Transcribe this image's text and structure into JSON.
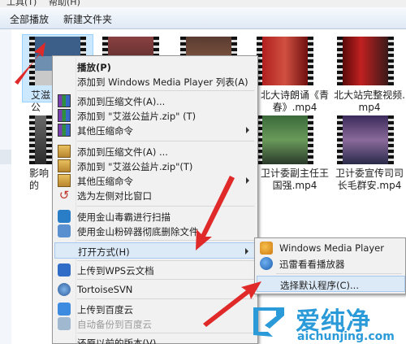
{
  "menubar": {
    "items": [
      "工具(T)",
      "帮助(H)"
    ]
  },
  "toolbar": {
    "play_all": "全部播放",
    "new_folder": "新建文件夹"
  },
  "files": [
    {
      "name": "艾滋公益片"
    },
    {
      "name": ""
    },
    {
      "name": ""
    },
    {
      "name": ""
    },
    {
      "name": "北大诗朗诵《青春》.mp4"
    },
    {
      "name": "北大站完整视频.mp4"
    },
    {
      "name": "影响的"
    },
    {
      "name": ""
    },
    {
      "name": ""
    },
    {
      "name": ""
    },
    {
      "name": "卫计委副主任王国强.mp4"
    },
    {
      "name": "卫计委宣传司司长毛群安.mp4"
    }
  ],
  "file_captions": {
    "f0": "艾滋公",
    "f4a": "北大诗朗诵《青",
    "f4b": "春》.mp4",
    "f5a": "北大站完整视频.",
    "f5b": "mp4",
    "f6": "影响的",
    "f10a": "卫计委副主任王",
    "f10b": "国强.mp4",
    "f11a": "卫计委宣传司司",
    "f11b": "长毛群安.mp4"
  },
  "context_menu": {
    "play": "播放(P)",
    "add_wmp": "添加到 Windows Media Player 列表(A)",
    "add_archive_1": "添加到压缩文件(A)...",
    "add_zip_1": "添加到 \"艾滋公益片.zip\" (T)",
    "other_compress_1": "其他压缩命令",
    "add_archive_2": "添加到压缩文件(A) ...",
    "add_zip_2": "添加到 \"艾滋公益片.zip\"(T)",
    "other_compress_2": "其他压缩命令",
    "compare": "选为左侧对比窗口",
    "scan": "使用金山毒霸进行扫描",
    "shred": "使用金山粉碎器彻底删除文件",
    "open_with": "打开方式(H)",
    "wps_upload": "上传到WPS云文档",
    "svn": "TortoiseSVN",
    "baidu_upload": "上传到百度云",
    "baidu_backup": "自动备份到百度云",
    "restore": "还原以前的版本(V)"
  },
  "submenu": {
    "wmp": "Windows Media Player",
    "thunder": "迅雷看看播放器",
    "choose_default": "选择默认程序(C)..."
  },
  "watermark": {
    "name": "爱纯净",
    "url": "aichunjing.com"
  },
  "colors": {
    "accent": "#2a9ad8",
    "arrow": "#e02a2a",
    "highlight": "#dce9f7"
  }
}
